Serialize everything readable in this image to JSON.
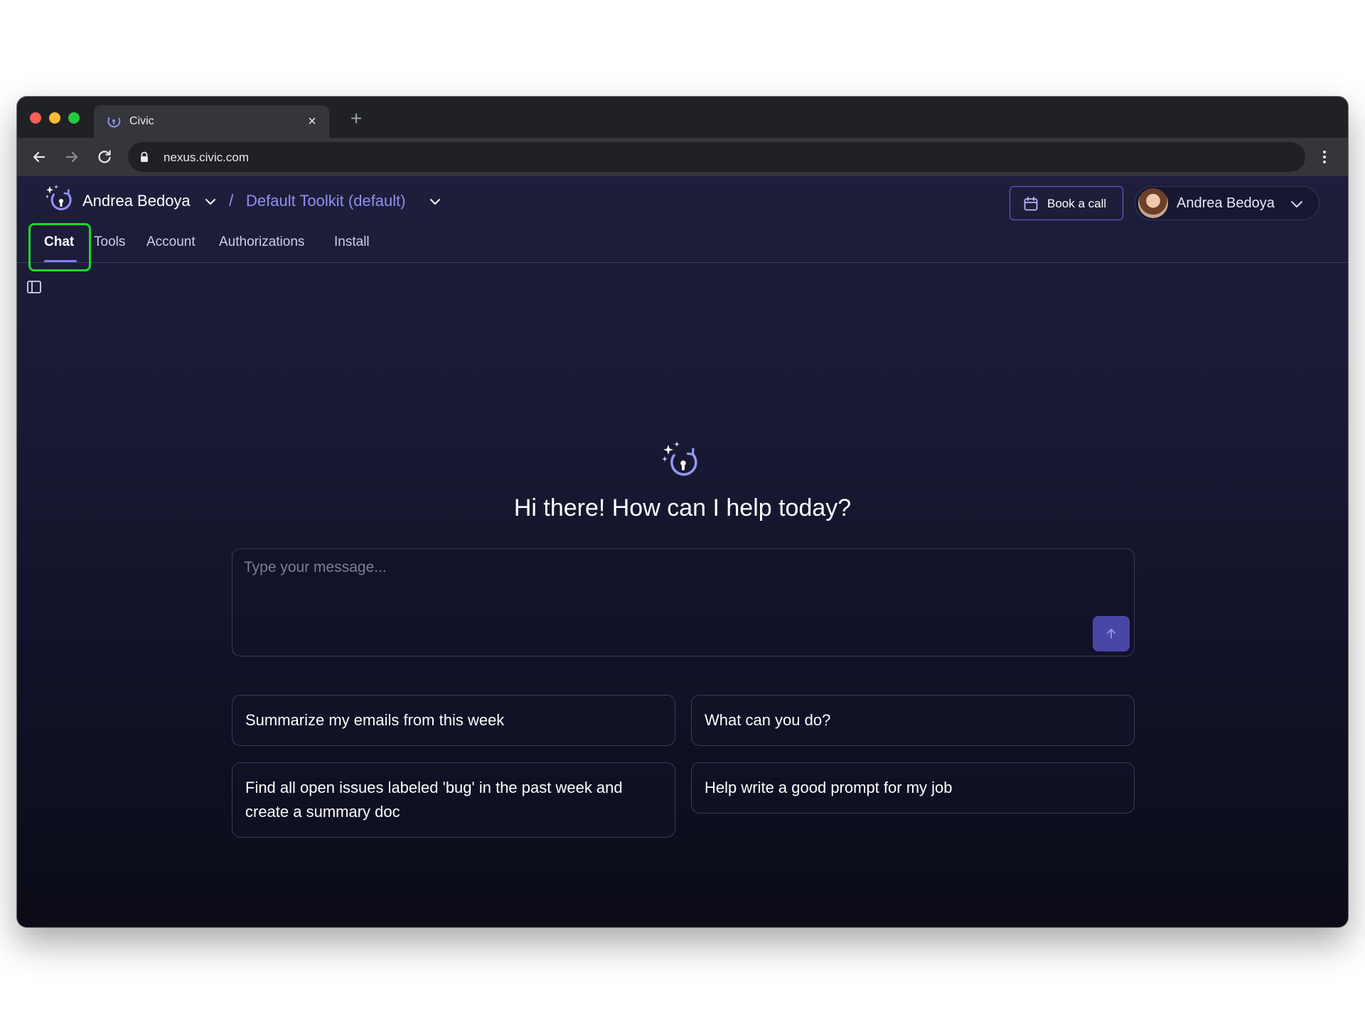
{
  "browser": {
    "tab_title": "Civic",
    "tab_close": "×",
    "new_tab": "+",
    "url": "nexus.civic.com"
  },
  "header": {
    "org_name": "Andrea Bedoya",
    "separator": "/",
    "toolkit": "Default Toolkit (default)",
    "book_call_label": "Book a call",
    "user_name": "Andrea Bedoya"
  },
  "nav": {
    "tabs": [
      {
        "label": "Chat",
        "active": true
      },
      {
        "label": "Tools"
      },
      {
        "label": "Account"
      },
      {
        "label": "Authorizations"
      },
      {
        "label": "Install"
      }
    ]
  },
  "chat": {
    "greeting": "Hi there! How can I help today?",
    "input_placeholder": "Type your message...",
    "suggestions": [
      "Summarize my emails from this week",
      "What can you do?",
      "Find all open issues labeled 'bug' in the past week and create a summary doc",
      "Help write a good prompt for my job"
    ]
  },
  "colors": {
    "accent": "#8f90f0",
    "highlight": "#1ed72a",
    "send_button": "#4a46a6"
  },
  "icons": [
    "civic-logo-icon",
    "chevron-down-icon",
    "calendar-icon",
    "sidebar-toggle-icon",
    "arrow-up-icon",
    "lock-icon",
    "back-arrow-icon",
    "forward-arrow-icon",
    "reload-icon",
    "more-vert-icon"
  ]
}
